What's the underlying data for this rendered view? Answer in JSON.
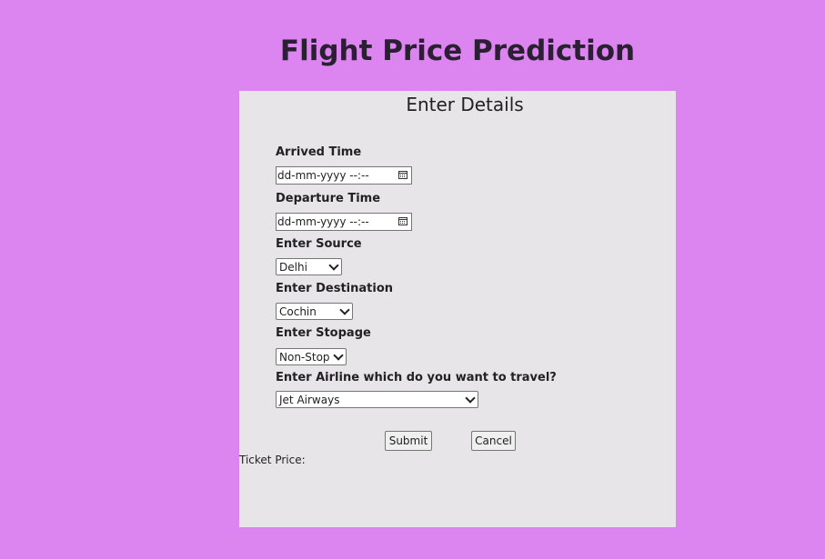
{
  "page": {
    "title": "Flight Price Prediction"
  },
  "form": {
    "heading": "Enter Details",
    "arrived_time": {
      "label": "Arrived Time",
      "value": "dd-mm-yyyy --:--"
    },
    "departure_time": {
      "label": "Departure Time",
      "value": "dd-mm-yyyy --:--"
    },
    "source": {
      "label": "Enter Source",
      "selected": "Delhi"
    },
    "destination": {
      "label": "Enter Destination",
      "selected": "Cochin"
    },
    "stopage": {
      "label": "Enter Stopage",
      "selected": "Non-Stop"
    },
    "airline": {
      "label": "Enter Airline which do you want to travel?",
      "selected": "Jet Airways"
    },
    "submit_label": "Submit",
    "cancel_label": "Cancel"
  },
  "result": {
    "label": "Ticket Price:"
  },
  "colors": {
    "page_background": "#dc84ef",
    "card_background": "#e7e5e8",
    "title_color": "#2b2033"
  },
  "icons": {
    "date_picker": "calendar-icon",
    "dropdown": "chevron-down-icon"
  }
}
